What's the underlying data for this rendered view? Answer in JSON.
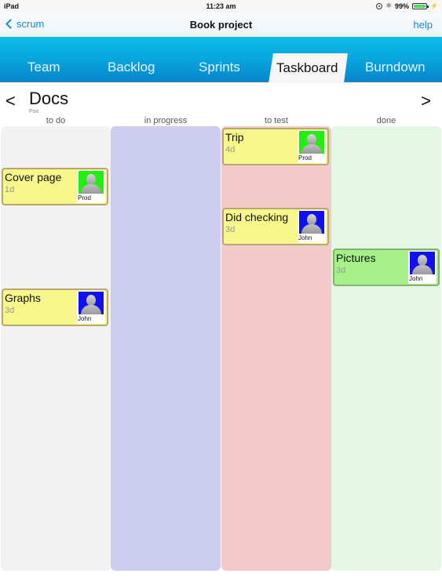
{
  "status_bar": {
    "device": "iPad",
    "time": "11:23 am",
    "battery": "99%",
    "battery_level": 0.99
  },
  "nav": {
    "back_label": "scrum",
    "title": "Book project",
    "help_label": "help"
  },
  "tabs": [
    {
      "label": "Team",
      "active": false
    },
    {
      "label": "Backlog",
      "active": false
    },
    {
      "label": "Sprints",
      "active": false
    },
    {
      "label": "Taskboard",
      "active": true
    },
    {
      "label": "Burndown",
      "active": false
    }
  ],
  "sprint": {
    "prev_label": "<",
    "next_label": ">",
    "title": "Docs",
    "subtitle": "Poo"
  },
  "columns": [
    {
      "label": "to do",
      "color": "#f2f2f2"
    },
    {
      "label": "in progress",
      "color": "#cdcdf0"
    },
    {
      "label": "to test",
      "color": "#f2caca"
    },
    {
      "label": "done",
      "color": "#e4f6e4"
    }
  ],
  "cards": [
    {
      "title": "Cover page",
      "estimate": "1d",
      "column": "to do",
      "assignee": "Prod",
      "avatar_color": "green",
      "card_color": "#f7f78c"
    },
    {
      "title": "Graphs",
      "estimate": "3d",
      "column": "to do",
      "assignee": "John",
      "avatar_color": "blue",
      "card_color": "#f7f78c"
    },
    {
      "title": "Trip",
      "estimate": "4d",
      "column": "to test",
      "assignee": "Prod",
      "avatar_color": "green",
      "card_color": "#f7f78c"
    },
    {
      "title": "Did checking",
      "estimate": "3d",
      "column": "to test",
      "assignee": "John",
      "avatar_color": "blue",
      "card_color": "#f7f78c"
    },
    {
      "title": "Pictures",
      "estimate": "3d",
      "column": "done",
      "assignee": "John",
      "avatar_color": "blue",
      "card_color": "#a6f08a"
    }
  ]
}
